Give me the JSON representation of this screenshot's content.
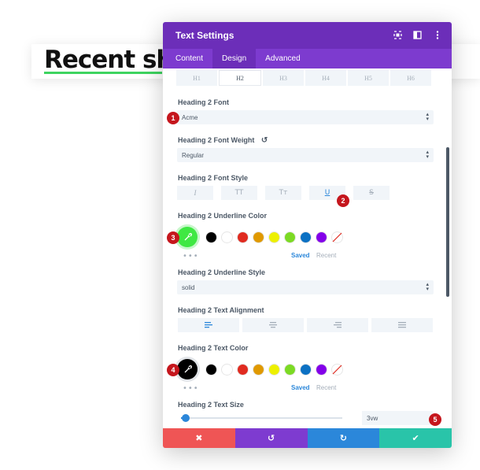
{
  "background": {
    "title": "Recent shot"
  },
  "modal": {
    "title": "Text Settings",
    "tabs": [
      "Content",
      "Design",
      "Advanced"
    ],
    "active_tab": 1,
    "heading_levels": [
      "H1",
      "H2",
      "H3",
      "H4",
      "H5",
      "H6"
    ],
    "active_heading": 1,
    "font": {
      "label": "Heading 2 Font",
      "value": "Acme"
    },
    "font_weight": {
      "label": "Heading 2 Font Weight",
      "value": "Regular"
    },
    "font_style": {
      "label": "Heading 2 Font Style",
      "buttons": [
        "I",
        "TT",
        "Tт",
        "U",
        "S"
      ],
      "active": 3
    },
    "underline_color": {
      "label": "Heading 2 Underline Color",
      "selected": "#3fe843"
    },
    "underline_style": {
      "label": "Heading 2 Underline Style",
      "value": "solid"
    },
    "text_alignment": {
      "label": "Heading 2 Text Alignment"
    },
    "text_color": {
      "label": "Heading 2 Text Color",
      "selected": "#000000"
    },
    "text_size": {
      "label": "Heading 2 Text Size",
      "value": "3vw",
      "slider_percent": 2
    },
    "swatches": [
      "#000000",
      "#ffffff",
      "#e02b20",
      "#e09900",
      "#edf000",
      "#7cda24",
      "#0c71c3",
      "#8300e9"
    ],
    "saved_label": "Saved",
    "recent_label": "Recent",
    "dots": "•••"
  },
  "badges": [
    "1",
    "2",
    "3",
    "4",
    "5"
  ]
}
